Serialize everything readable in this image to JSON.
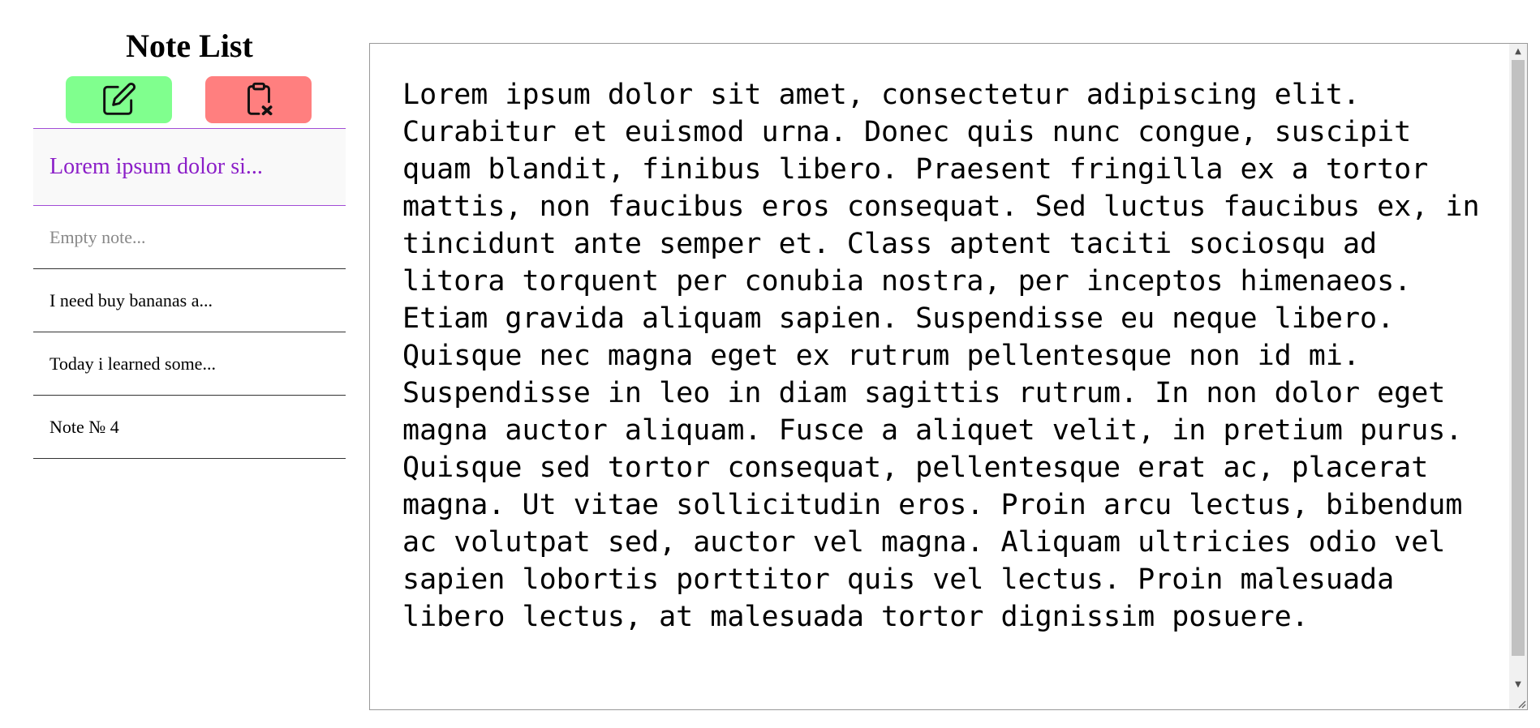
{
  "sidebar": {
    "title": "Note List",
    "new_button_icon": "edit-icon",
    "delete_button_icon": "clipboard-x-icon",
    "notes": [
      "Lorem ipsum dolor si...",
      "Empty note...",
      "I need buy bananas a...",
      "Today i learned some...",
      "Note № 4"
    ],
    "active_index": 0
  },
  "editor": {
    "content": "Lorem ipsum dolor sit amet, consectetur adipiscing elit. Curabitur et euismod urna. Donec quis nunc congue, suscipit quam blandit, finibus libero. Praesent fringilla ex a tortor mattis, non faucibus eros consequat. Sed luctus faucibus ex, in tincidunt ante semper et. Class aptent taciti sociosqu ad litora torquent per conubia nostra, per inceptos himenaeos. Etiam gravida aliquam sapien. Suspendisse eu neque libero. Quisque nec magna eget ex rutrum pellentesque non id mi. Suspendisse in leo in diam sagittis rutrum. In non dolor eget magna auctor aliquam. Fusce a aliquet velit, in pretium purus. Quisque sed tortor consequat, pellentesque erat ac, placerat magna. Ut vitae sollicitudin eros. Proin arcu lectus, bibendum ac volutpat sed, auctor vel magna. Aliquam ultricies odio vel sapien lobortis porttitor quis vel lectus. Proin malesuada libero lectus, at malesuada tortor dignissim posuere."
  },
  "colors": {
    "new_button": "#80ff8e",
    "delete_button": "#ff7f7f",
    "active_note_text": "#8b1ec8",
    "active_note_border": "#a24cd6",
    "empty_note_text": "#888888"
  }
}
